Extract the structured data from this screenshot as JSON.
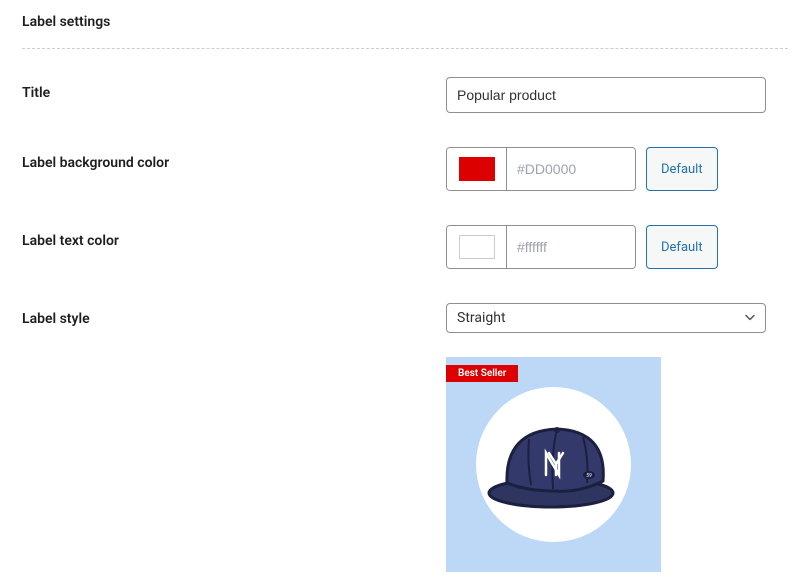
{
  "section_title": "Label settings",
  "fields": {
    "title": {
      "label": "Title",
      "value": "Popular product"
    },
    "bg_color": {
      "label": "Label background color",
      "swatch": "#DD0000",
      "placeholder": "#DD0000",
      "default_btn": "Default"
    },
    "text_color": {
      "label": "Label text color",
      "swatch": "#ffffff",
      "placeholder": "#ffffff",
      "default_btn": "Default"
    },
    "label_style": {
      "label": "Label style",
      "value": "Straight"
    }
  },
  "preview": {
    "label_text": "Best Seller"
  }
}
